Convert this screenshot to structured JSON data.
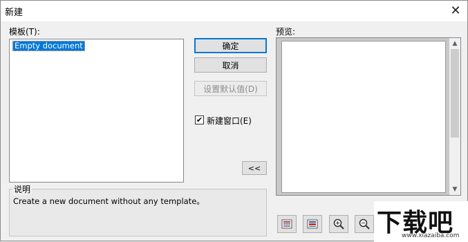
{
  "dialog": {
    "title": "新建",
    "close_glyph": "✕"
  },
  "templates": {
    "label": "模板(T):",
    "items": [
      "Empty document"
    ]
  },
  "buttons": {
    "ok": "确定",
    "cancel": "取消",
    "set_default": "设置默认值(D)",
    "collapse": "<<"
  },
  "new_window": {
    "label": "新建窗口(E)",
    "checked": true
  },
  "description": {
    "title": "说明",
    "text": "Create a new document without any template。"
  },
  "preview": {
    "label": "预览:"
  },
  "toolbar_icons": [
    "page-view-icon",
    "fit-width-icon",
    "zoom-in-icon",
    "zoom-out-icon"
  ],
  "watermark": {
    "big": "下载吧",
    "url": "www.xiazaiba.com"
  },
  "colors": {
    "selection": "#0078d7",
    "primary_border": "#0078d7"
  }
}
